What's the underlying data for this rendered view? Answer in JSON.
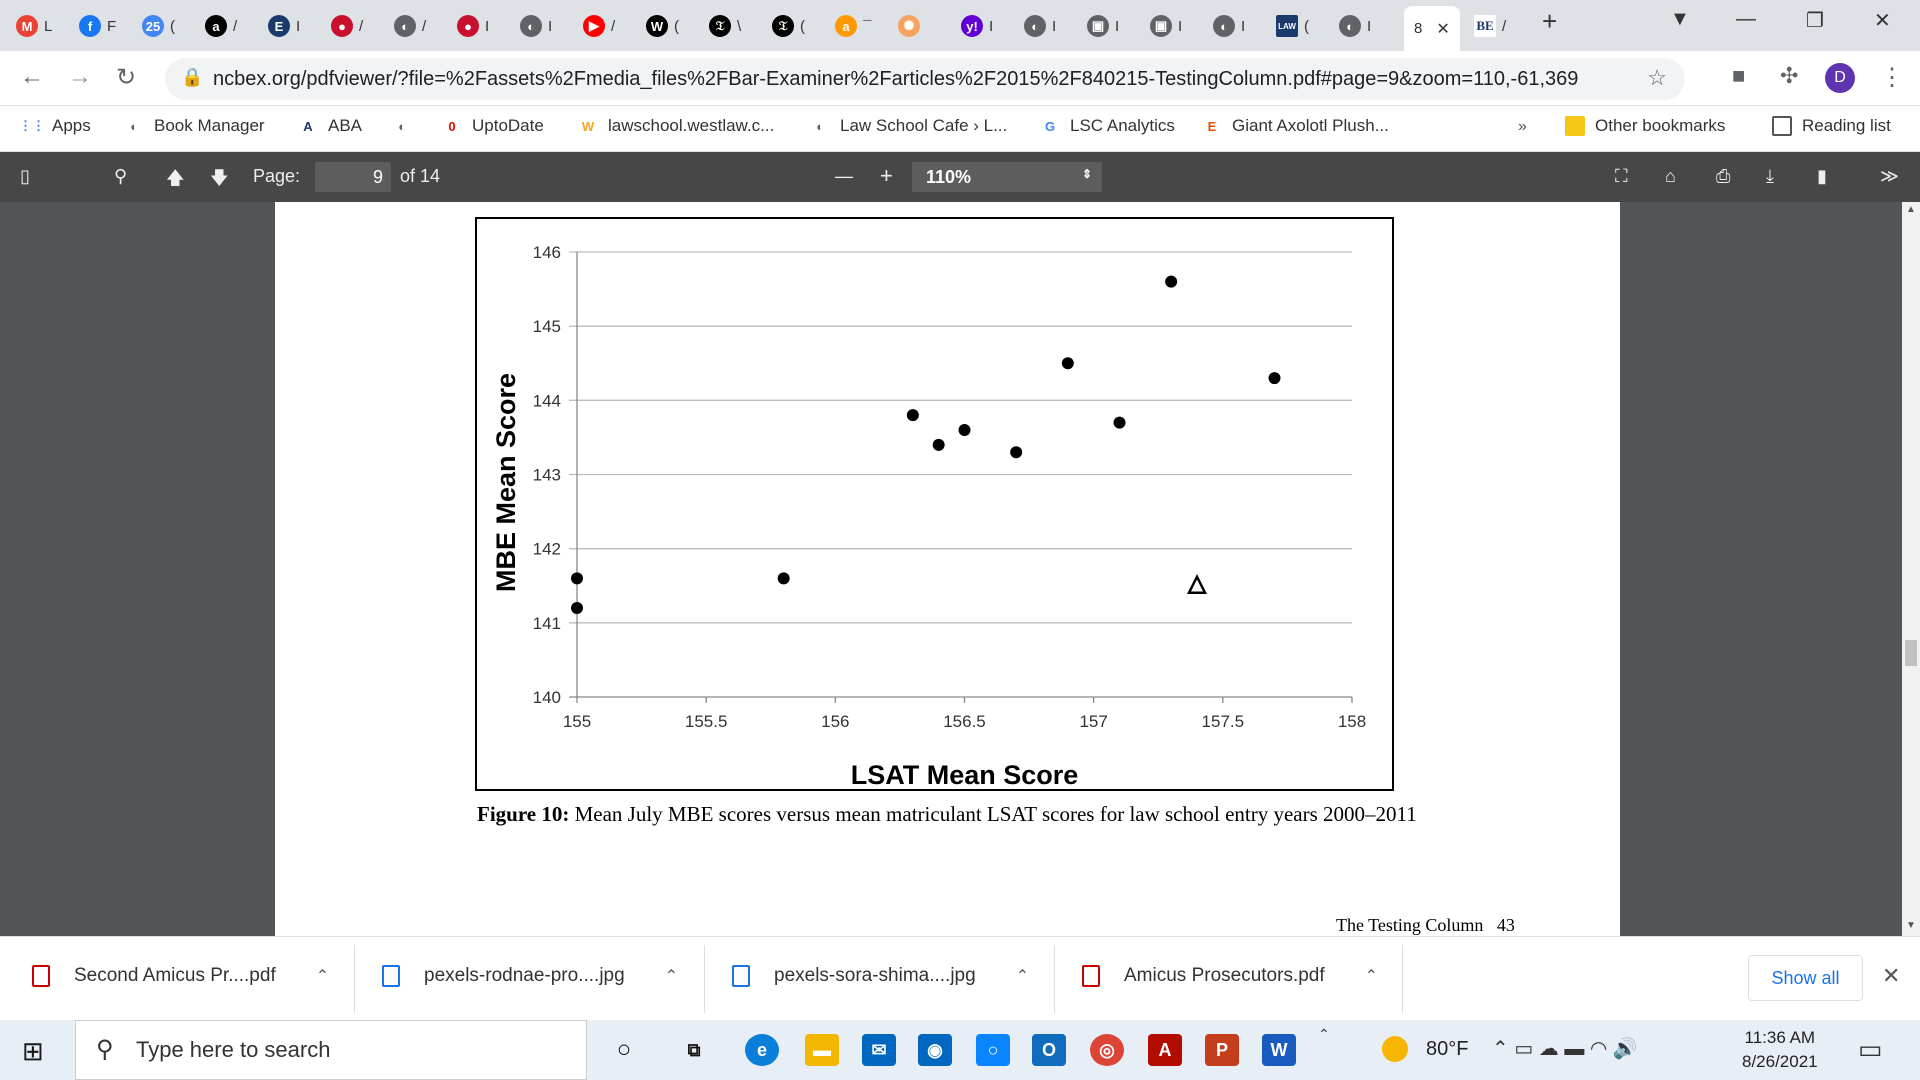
{
  "tabs": [
    {
      "icon": "M",
      "label": "L",
      "color": "#ea4335",
      "icon_name": "gmail-icon"
    },
    {
      "icon": "f",
      "label": "F",
      "color": "#1877f2",
      "icon_name": "facebook-icon"
    },
    {
      "icon": "25",
      "label": "(",
      "color": "#4285f4",
      "icon_name": "calendar-icon"
    },
    {
      "icon": "a",
      "label": "/",
      "color": "#000000",
      "icon_name": "amazon-icon"
    },
    {
      "icon": "E",
      "label": "I",
      "color": "#1a3a6b",
      "icon_name": "encyclopedia-icon"
    },
    {
      "icon": "●",
      "label": "/",
      "color": "#c8102e",
      "icon_name": "news-icon"
    },
    {
      "icon": "◐",
      "label": "/",
      "color": "#5f6368",
      "icon_name": "globe-icon"
    },
    {
      "icon": "●",
      "label": "I",
      "color": "#c8102e",
      "icon_name": "news-icon"
    },
    {
      "icon": "◐",
      "label": "I",
      "color": "#5f6368",
      "icon_name": "globe-icon"
    },
    {
      "icon": "▶",
      "label": "/",
      "color": "#ff0000",
      "icon_name": "youtube-icon"
    },
    {
      "icon": "W",
      "label": "(",
      "color": "#000000",
      "icon_name": "w-icon"
    },
    {
      "icon": "𝔗",
      "label": "\\",
      "color": "#000000",
      "icon_name": "nytimes-icon"
    },
    {
      "icon": "𝔗",
      "label": "(",
      "color": "#000000",
      "icon_name": "nytimes-icon"
    },
    {
      "icon": "a",
      "label": "¯",
      "color": "#ff9900",
      "icon_name": "amazon-icon"
    },
    {
      "icon": "✺",
      "label": "",
      "color": "#f4a460",
      "icon_name": "sun-icon"
    },
    {
      "icon": "y!",
      "label": "I",
      "color": "#6001d2",
      "icon_name": "yahoo-icon"
    },
    {
      "icon": "◐",
      "label": "I",
      "color": "#5f6368",
      "icon_name": "globe-icon"
    },
    {
      "icon": "▣",
      "label": "I",
      "color": "#5f6368",
      "icon_name": "square-icon"
    },
    {
      "icon": "▣",
      "label": "I",
      "color": "#5f6368",
      "icon_name": "square-icon"
    },
    {
      "icon": "◐",
      "label": "I",
      "color": "#5f6368",
      "icon_name": "globe-icon"
    },
    {
      "icon": "LAW",
      "label": "(",
      "color": "#1a3a6b",
      "icon_name": "law-icon"
    },
    {
      "icon": "◐",
      "label": "I",
      "color": "#5f6368",
      "icon_name": "globe-icon"
    }
  ],
  "active_tab": {
    "label": "8",
    "close": "✕"
  },
  "tab_after": {
    "icon": "BE",
    "label": "/"
  },
  "new_tab": "+",
  "address": {
    "url": "ncbex.org/pdfviewer/?file=%2Fassets%2Fmedia_files%2FBar-Examiner%2Farticles%2F2015%2F840215-TestingColumn.pdf#page=9&zoom=110,-61,369",
    "profile": "D"
  },
  "bookmarks": [
    {
      "label": "Apps",
      "icon": "⋮⋮"
    },
    {
      "label": "Book Manager",
      "icon": "◐"
    },
    {
      "label": "ABA",
      "icon": "A"
    },
    {
      "label": "",
      "icon": "◐"
    },
    {
      "label": "UptoDate",
      "icon": "0"
    },
    {
      "label": "lawschool.westlaw.c...",
      "icon": "W"
    },
    {
      "label": "Law School Cafe › L...",
      "icon": "◐"
    },
    {
      "label": "LSC Analytics",
      "icon": "G"
    },
    {
      "label": "Giant Axolotl Plush...",
      "icon": "E"
    }
  ],
  "bookmarks_more": "»",
  "other_bookmarks": "Other bookmarks",
  "reading_list": "Reading list",
  "pdf_toolbar": {
    "page_label": "Page:",
    "page_value": "9",
    "page_total": "of 14",
    "zoom": "110%",
    "minus": "—",
    "plus": "+"
  },
  "chart_data": {
    "type": "scatter",
    "title": "",
    "xlabel": "LSAT Mean Score",
    "ylabel": "MBE Mean Score",
    "xlim": [
      155,
      158
    ],
    "ylim": [
      140,
      146
    ],
    "xticks": [
      "155",
      "155.5",
      "156",
      "156.5",
      "157",
      "157.5",
      "158"
    ],
    "yticks": [
      "140",
      "141",
      "142",
      "143",
      "144",
      "145",
      "146"
    ],
    "grid": "horizontal",
    "series": [
      {
        "marker": "circle",
        "points": [
          [
            155,
            141.6
          ],
          [
            155,
            141.2
          ],
          [
            155.8,
            141.6
          ],
          [
            156.3,
            143.8
          ],
          [
            156.4,
            143.4
          ],
          [
            156.5,
            143.6
          ],
          [
            156.7,
            143.3
          ],
          [
            156.9,
            144.5
          ],
          [
            157.1,
            143.7
          ],
          [
            157.3,
            145.6
          ],
          [
            157.7,
            144.3
          ]
        ]
      },
      {
        "marker": "triangle",
        "points": [
          [
            157.4,
            141.5
          ]
        ]
      }
    ]
  },
  "caption": {
    "label": "Figure 10:",
    "text": " Mean July MBE scores versus mean matriculant LSAT scores for law school entry years 2000–2011"
  },
  "footer": {
    "title": "The Testing Column",
    "page": "43"
  },
  "downloads": [
    {
      "name": "Second Amicus Pr....pdf",
      "type": "pdf"
    },
    {
      "name": "pexels-rodnae-pro....jpg",
      "type": "img"
    },
    {
      "name": "pexels-sora-shima....jpg",
      "type": "img"
    },
    {
      "name": "Amicus Prosecutors.pdf",
      "type": "pdf"
    }
  ],
  "show_all": "Show all",
  "taskbar": {
    "search_placeholder": "Type here to search",
    "weather": "80°F",
    "time": "11:36 AM",
    "date": "8/26/2021"
  }
}
